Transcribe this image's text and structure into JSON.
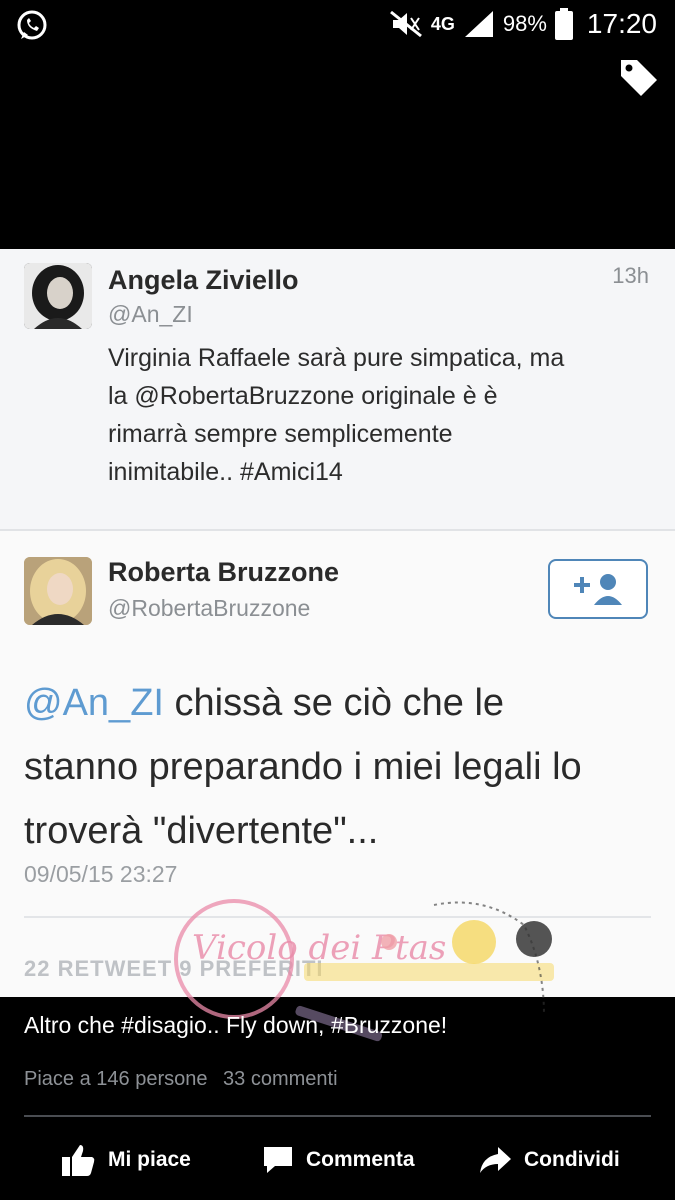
{
  "status_bar": {
    "left_icon": "whatsapp-icon",
    "network": "4G",
    "battery_percent": "98%",
    "time": "17:20"
  },
  "tweet1": {
    "name": "Angela Ziviello",
    "handle": "@An_ZI",
    "time": "13h",
    "text_lines": [
      "Virginia Raffaele sarà pure simpatica, ma",
      "la @RobertaBruzzone originale è è",
      "rimarrà sempre semplicemente",
      "inimitabile.. #Amici14"
    ]
  },
  "tweet2": {
    "name": "Roberta Bruzzone",
    "handle": "@RobertaBruzzone",
    "follow_icon": "add-user-icon",
    "text_mention": "@An_ZI",
    "text_line1_rest": " chissà se ciò che le",
    "text_line2": "stanno preparando i miei legali lo",
    "text_line3": "troverà \"divertente\"...",
    "date": "09/05/15 23:27",
    "stats": "22 RETWEET   9 PREFERITI"
  },
  "watermark": {
    "brand": "Vicolo dei Ptas"
  },
  "post": {
    "caption": "Altro che #disagio.. Fly down, #Bruzzone!",
    "likes": "Piace a 146 persone",
    "comments": "33 commenti"
  },
  "actions": {
    "like": "Mi piace",
    "comment": "Commenta",
    "share": "Condividi"
  },
  "colors": {
    "mention": "#5e9bd1",
    "follow_border": "#4f86b8",
    "background": "#000000"
  }
}
